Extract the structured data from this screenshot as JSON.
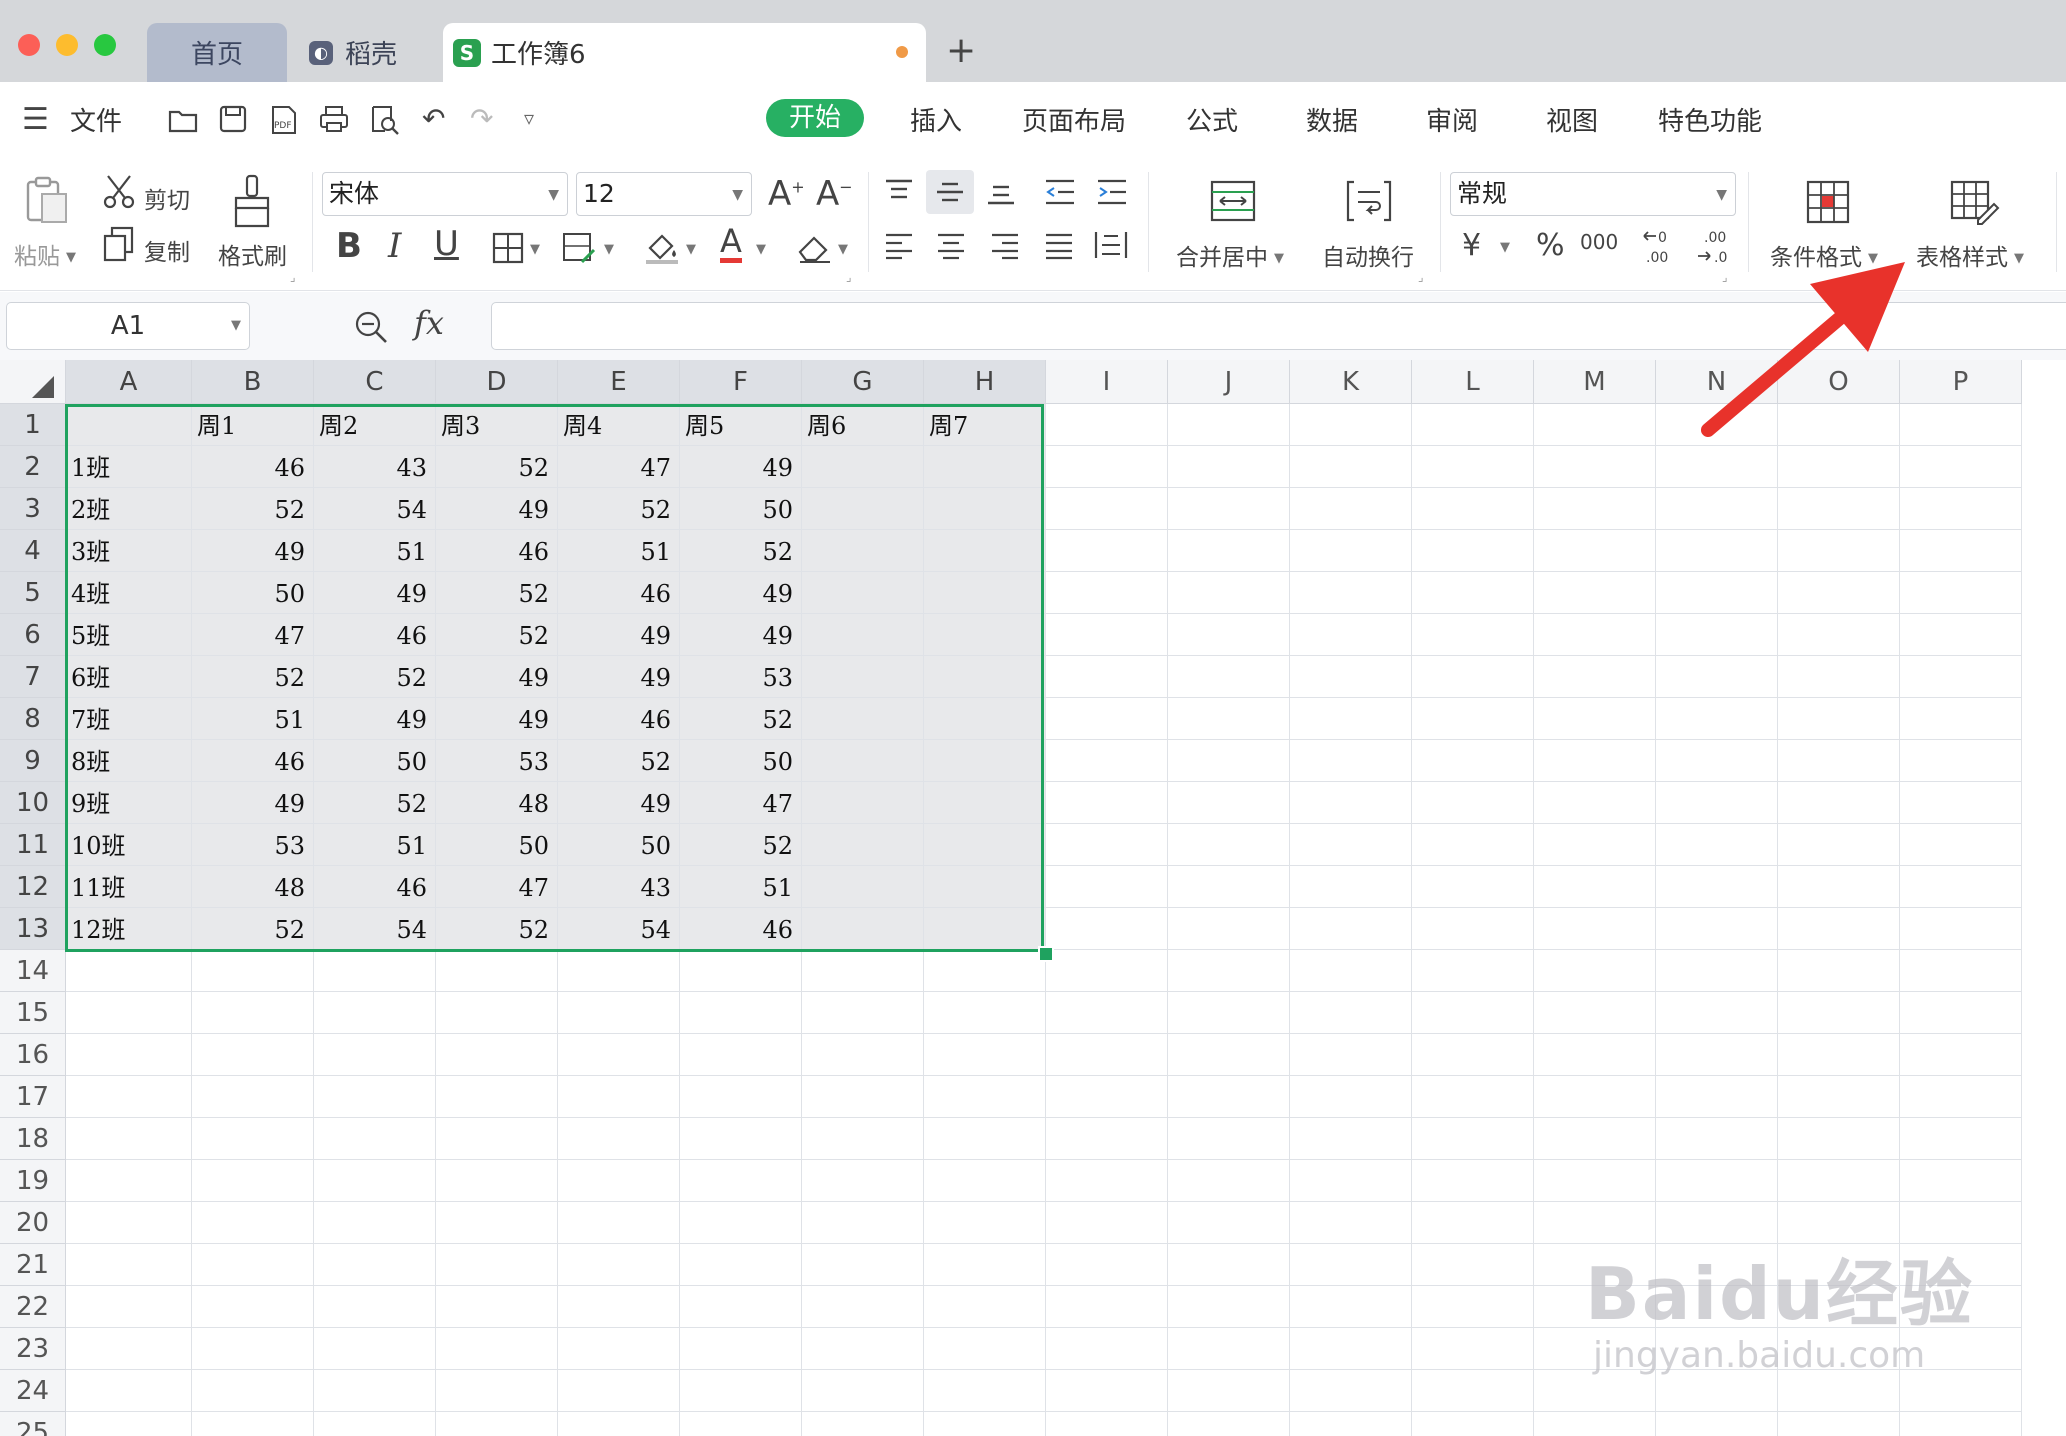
{
  "tabs": {
    "home": "首页",
    "daoke": "稻壳",
    "workbook": "工作簿6",
    "add": "+"
  },
  "menu": {
    "file": "文件",
    "items": [
      "开始",
      "插入",
      "页面布局",
      "公式",
      "数据",
      "审阅",
      "视图",
      "特色功能"
    ]
  },
  "ribbon": {
    "paste": "粘贴",
    "cut": "剪切",
    "copy": "复制",
    "format_painter": "格式刷",
    "font_name": "宋体",
    "font_size": "12",
    "merge_center": "合并居中",
    "wrap_text": "自动换行",
    "number_format": "常规",
    "currency": "¥",
    "percent": "%",
    "thousands": "000",
    "conditional_format": "条件格式",
    "table_style": "表格样式"
  },
  "formula_bar": {
    "name_box": "A1",
    "fx": "fx",
    "value": ""
  },
  "grid": {
    "columns": [
      "A",
      "B",
      "C",
      "D",
      "E",
      "F",
      "G",
      "H",
      "I",
      "J",
      "K",
      "L",
      "M",
      "N",
      "O",
      "P"
    ],
    "rows": [
      "1",
      "2",
      "3",
      "4",
      "5",
      "6",
      "7",
      "8",
      "9",
      "10",
      "11",
      "12",
      "13",
      "14",
      "15",
      "16",
      "17",
      "18",
      "19",
      "20",
      "21",
      "22",
      "23",
      "24",
      "25"
    ],
    "header_row": [
      "",
      "周1",
      "周2",
      "周3",
      "周4",
      "周5",
      "周6",
      "周7"
    ],
    "data": [
      [
        "1班",
        46,
        43,
        52,
        47,
        49,
        null,
        null
      ],
      [
        "2班",
        52,
        54,
        49,
        52,
        50,
        null,
        null
      ],
      [
        "3班",
        49,
        51,
        46,
        51,
        52,
        null,
        null
      ],
      [
        "4班",
        50,
        49,
        52,
        46,
        49,
        null,
        null
      ],
      [
        "5班",
        47,
        46,
        52,
        49,
        49,
        null,
        null
      ],
      [
        "6班",
        52,
        52,
        49,
        49,
        53,
        null,
        null
      ],
      [
        "7班",
        51,
        49,
        49,
        46,
        52,
        null,
        null
      ],
      [
        "8班",
        46,
        50,
        53,
        52,
        50,
        null,
        null
      ],
      [
        "9班",
        49,
        52,
        48,
        49,
        47,
        null,
        null
      ],
      [
        "10班",
        53,
        51,
        50,
        50,
        52,
        null,
        null
      ],
      [
        "11班",
        48,
        46,
        47,
        43,
        51,
        null,
        null
      ],
      [
        "12班",
        52,
        54,
        52,
        54,
        46,
        null,
        null
      ]
    ]
  },
  "watermark": {
    "logo": "Baidu经验",
    "url": "jingyan.baidu.com"
  },
  "colors": {
    "accent": "#27b063",
    "selection_border": "#1fa25f",
    "arrow": "#e8322b",
    "tab_dot": "#f09a47"
  }
}
